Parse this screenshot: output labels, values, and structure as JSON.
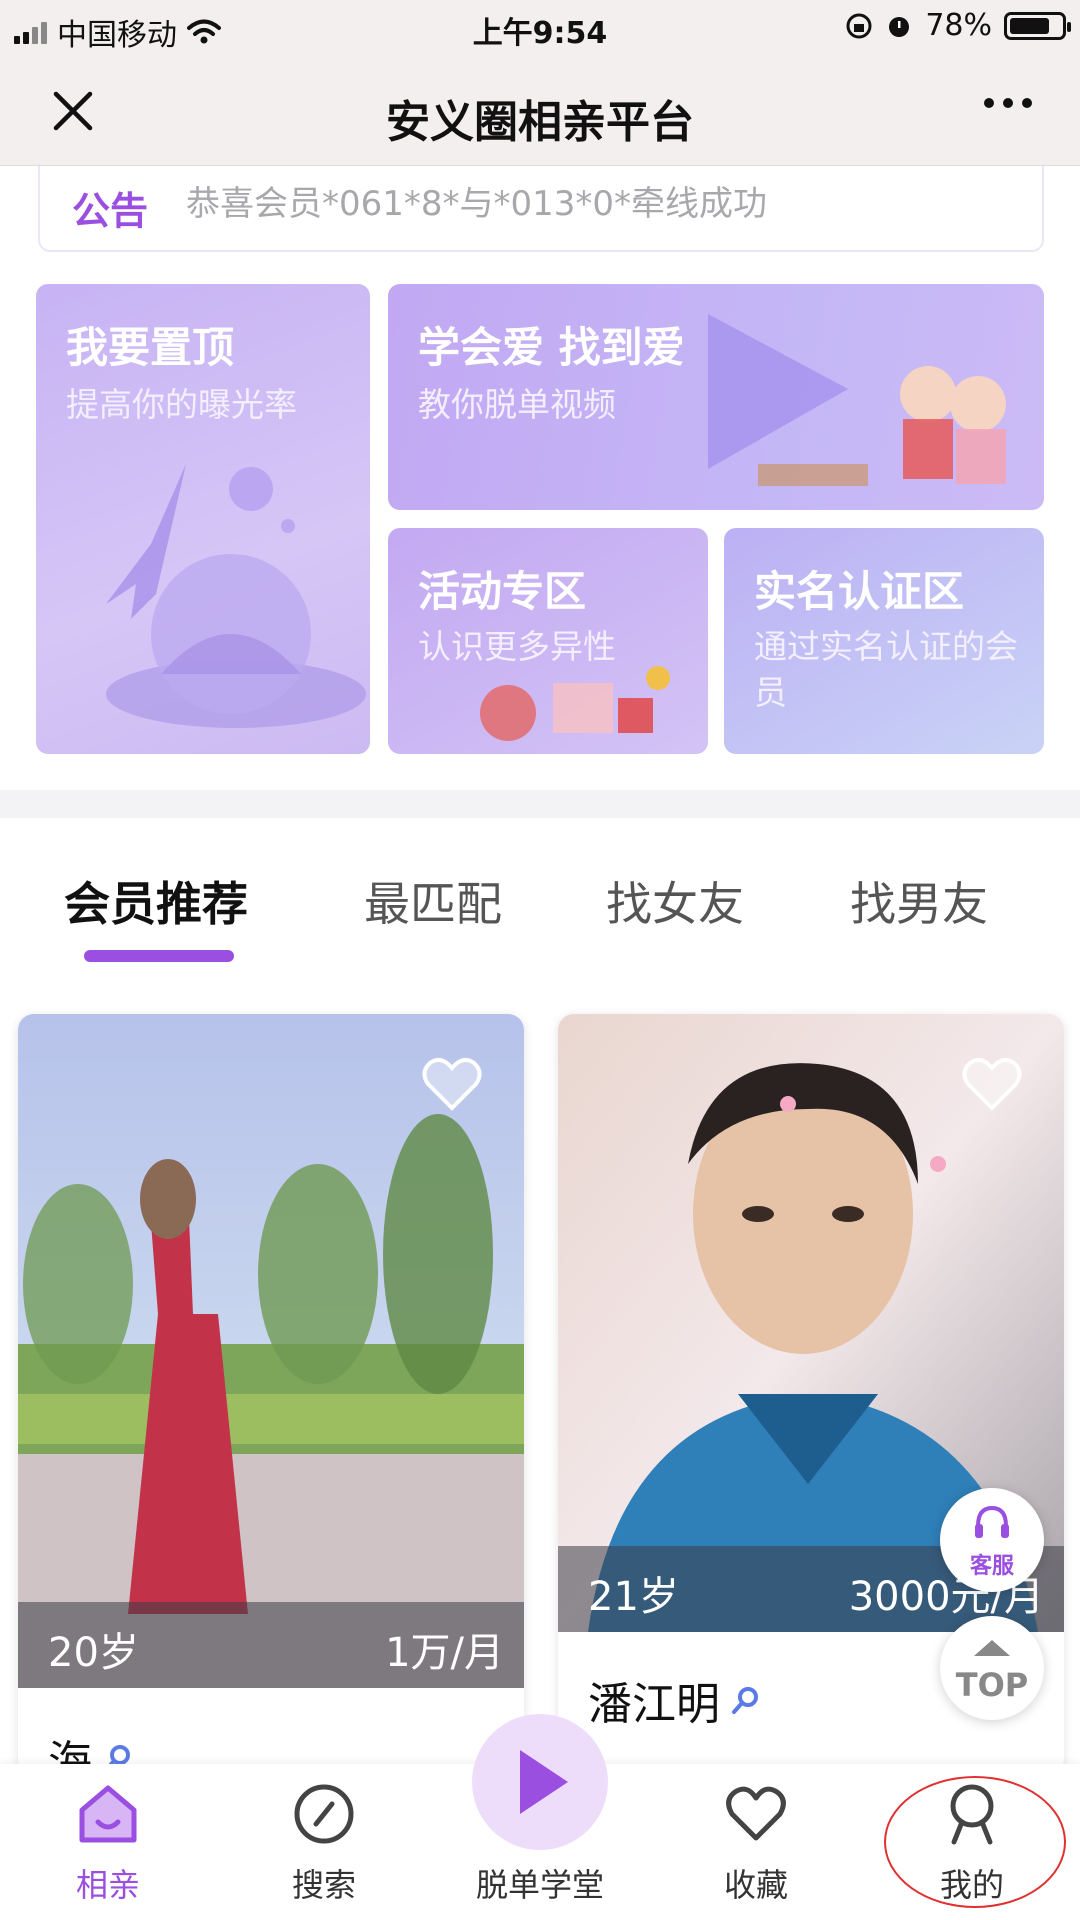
{
  "status_bar": {
    "carrier": "中国移动",
    "time": "上午9:54",
    "battery": "78%",
    "battery_level": 0.78
  },
  "nav": {
    "title": "安义圈相亲平台"
  },
  "notice": {
    "label": "公告",
    "text": "恭喜会员*061*8*与*013*0*牵线成功"
  },
  "promo": {
    "top": {
      "title": "我要置顶",
      "subtitle": "提高你的曝光率"
    },
    "love": {
      "title": "学会爱 找到爱",
      "subtitle": "教你脱单视频"
    },
    "activity": {
      "title": "活动专区",
      "subtitle": "认识更多异性"
    },
    "realname": {
      "title": "实名认证区",
      "subtitle": "通过实名认证的会员"
    }
  },
  "tabs": [
    {
      "label": "会员推荐",
      "active": true
    },
    {
      "label": "最匹配",
      "active": false
    },
    {
      "label": "找女友",
      "active": false
    },
    {
      "label": "找男友",
      "active": false
    }
  ],
  "members": [
    {
      "age": "20岁",
      "income": "1万/月",
      "name": "海"
    },
    {
      "age": "21岁",
      "income": "3000元/月",
      "name": "潘江明"
    }
  ],
  "floating": {
    "service": "客服",
    "top": "TOP"
  },
  "bottom_nav": [
    {
      "label": "相亲",
      "icon": "home-icon",
      "active": true
    },
    {
      "label": "搜索",
      "icon": "compass-icon",
      "active": false
    },
    {
      "label": "脱单学堂",
      "icon": "play-icon",
      "active": false
    },
    {
      "label": "收藏",
      "icon": "heart-icon",
      "active": false
    },
    {
      "label": "我的",
      "icon": "profile-icon",
      "active": false
    }
  ],
  "colors": {
    "accent": "#9a4fe0",
    "promo": "#c7b3f4",
    "annotation_circle": "#e03030"
  }
}
